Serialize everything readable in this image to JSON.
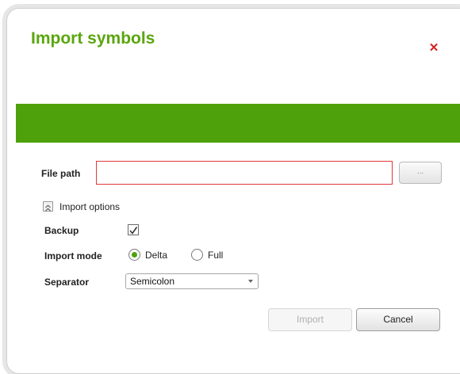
{
  "dialog": {
    "title": "Import symbols",
    "close_icon": "close-icon",
    "accent_color": "#4ea10a",
    "title_color": "#5aa60e"
  },
  "file_path": {
    "label": "File path",
    "value": "",
    "browse_label": "..."
  },
  "options": {
    "toggle_label": "Import options",
    "toggle_icon": "collapse-icon",
    "backup": {
      "label": "Backup",
      "checked": true
    },
    "import_mode": {
      "label": "Import mode",
      "choices": [
        "Delta",
        "Full"
      ],
      "selected": "Delta"
    },
    "separator": {
      "label": "Separator",
      "value": "Semicolon"
    }
  },
  "buttons": {
    "import_label": "Import",
    "import_enabled": false,
    "cancel_label": "Cancel"
  }
}
